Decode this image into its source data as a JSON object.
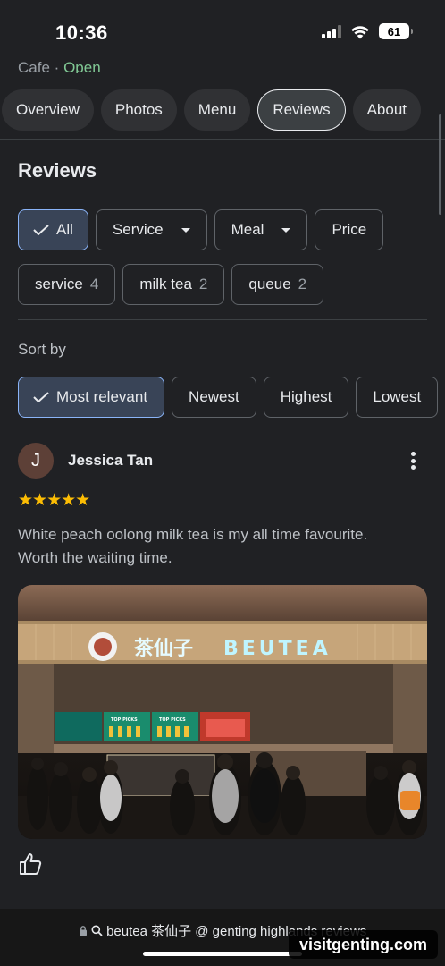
{
  "status_bar": {
    "time": "10:36",
    "battery": "61"
  },
  "place": {
    "category": "Cafe",
    "separator": "·",
    "open_status": "Open"
  },
  "tabs": [
    {
      "label": "Overview",
      "active": false
    },
    {
      "label": "Photos",
      "active": false
    },
    {
      "label": "Menu",
      "active": false
    },
    {
      "label": "Reviews",
      "active": true
    },
    {
      "label": "About",
      "active": false
    }
  ],
  "reviews_section": {
    "title": "Reviews",
    "filters": [
      {
        "label": "All",
        "selected": true
      },
      {
        "label": "Service",
        "dropdown": true
      },
      {
        "label": "Meal",
        "dropdown": true
      },
      {
        "label": "Price"
      }
    ],
    "topics": [
      {
        "label": "service",
        "count": "4"
      },
      {
        "label": "milk tea",
        "count": "2"
      },
      {
        "label": "queue",
        "count": "2"
      }
    ],
    "sort_label": "Sort by",
    "sort_options": [
      {
        "label": "Most relevant",
        "selected": true
      },
      {
        "label": "Newest"
      },
      {
        "label": "Highest"
      },
      {
        "label": "Lowest"
      }
    ]
  },
  "review": {
    "avatar_initial": "J",
    "avatar_color": "#5d4037",
    "reviewer": "Jessica Tan",
    "rating": 5,
    "stars": "★★★★★",
    "text": "White peach oolong milk tea is my all time favourite. Worth the waiting time.",
    "photo": {
      "sign_chinese": "茶仙子",
      "sign_english": "BEUTEA",
      "menu_board_label": "TOP PICKS"
    }
  },
  "bottom": {
    "url": "beutea 茶仙子 @ genting highlands reviews",
    "watermark": "visitgenting.com"
  },
  "colors": {
    "background": "#202124",
    "accent": "#8ab4f8",
    "chip_selected_bg": "#394457",
    "star": "#fbbc04",
    "open_green": "#81c995"
  }
}
